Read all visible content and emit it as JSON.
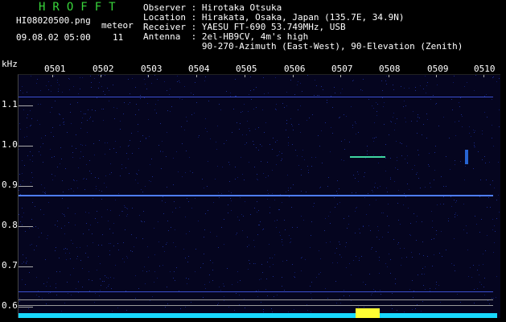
{
  "header": {
    "title": "HROFFT",
    "filename": "HI08020500.png",
    "meteor_label": "meteor",
    "datetime": "09.08.02 05:00",
    "meteor_count": "11"
  },
  "station": {
    "observer": "Observer : Hirotaka Otsuka",
    "location": "Location : Hirakata, Osaka, Japan (135.7E, 34.9N)",
    "receiver": "Receiver : YAESU FT-690 53.749MHz, USB",
    "antenna": "Antenna  : 2el-HB9CV, 4m's high",
    "antenna_detail": "           90-270-Azimuth (East-West), 90-Elevation (Zenith)"
  },
  "axes": {
    "y_unit": "kHz",
    "y_ticks": [
      "1.1",
      "1.0",
      "0.9",
      "0.8",
      "0.7",
      "0.6"
    ],
    "x_ticks": [
      "0501",
      "0502",
      "0503",
      "0504",
      "0505",
      "0506",
      "0507",
      "0508",
      "0509",
      "0510"
    ]
  },
  "colors": {
    "title": "#39d63b",
    "background": "#05051f",
    "carrier_line": "#4d7dff",
    "spectrum_bar": "#18d8ff",
    "meteor_echo": "#ffff33"
  }
}
